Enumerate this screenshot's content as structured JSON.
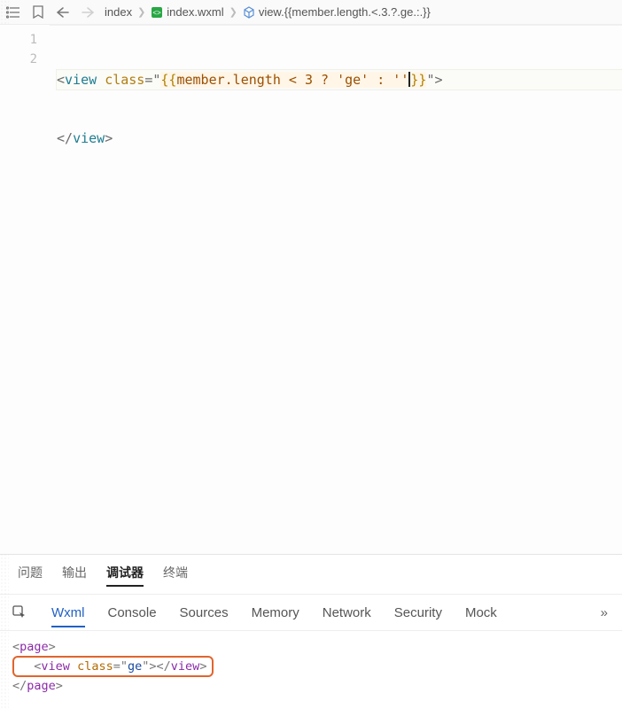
{
  "topbar": {
    "icons": {
      "list": "list-icon",
      "bookmark": "bookmark-icon",
      "back": "arrow-left-icon",
      "forward": "arrow-right-icon"
    }
  },
  "breadcrumbs": {
    "items": [
      {
        "label": "index",
        "icon": ""
      },
      {
        "label": "index.wxml",
        "icon": "file"
      },
      {
        "label": "view.{{member.length.<.3.?.ge.:.}}",
        "icon": "cube"
      }
    ]
  },
  "editor": {
    "lines": [
      1,
      2
    ],
    "current_line": 1,
    "tokens": {
      "line1": {
        "open_angle": "<",
        "view": "view",
        "space": " ",
        "class_attr": "class",
        "eq": "=",
        "q": "\"",
        "brace_open": "{{",
        "expr": "member.length < 3 ? 'ge' : ''",
        "brace_close": "}}",
        "close_angle": ">"
      },
      "line2": {
        "open_angle": "<",
        "slash": "/",
        "view": "view",
        "close_angle": ">"
      }
    }
  },
  "panel": {
    "tabs": [
      "问题",
      "输出",
      "调试器",
      "终端"
    ],
    "active_index": 2
  },
  "devtools": {
    "tabs": [
      "Wxml",
      "Console",
      "Sources",
      "Memory",
      "Network",
      "Security",
      "Mock"
    ],
    "active_index": 0,
    "more": "»"
  },
  "elements": {
    "line0": {
      "open": "<",
      "tag": "page",
      "close": ">"
    },
    "line1": {
      "open": "<",
      "tag": "view",
      "sp": " ",
      "attr": "class",
      "eq": "=",
      "q": "\"",
      "val": "ge",
      "q2": "\"",
      "mid": ">",
      "open2": "</",
      "tag2": "view",
      "close2": ">"
    },
    "line2": {
      "open": "</",
      "tag": "page",
      "close": ">"
    }
  }
}
